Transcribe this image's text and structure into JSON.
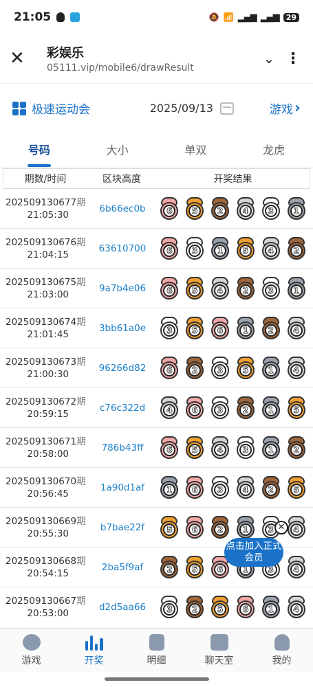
{
  "status": {
    "time": "21:05",
    "battery": "29"
  },
  "browser": {
    "title": "彩娱乐",
    "url": "05111.vip/mobile6/drawResult"
  },
  "game": {
    "name": "极速运动会",
    "date": "2025/09/13",
    "switch_label": "游戏"
  },
  "tabs": [
    "号码",
    "大小",
    "单双",
    "龙虎"
  ],
  "active_tab": 0,
  "table": {
    "headers": [
      "期数/时间",
      "区块高度",
      "开奖结果"
    ],
    "rows": [
      {
        "period": "202509130677",
        "qi": "期",
        "time": "21:05:30",
        "hash": "6b66ec0b",
        "balls": [
          6,
          5,
          2,
          4,
          3,
          1
        ]
      },
      {
        "period": "202509130676",
        "qi": "期",
        "time": "21:04:15",
        "hash": "63610700",
        "balls": [
          6,
          3,
          1,
          5,
          4,
          2
        ]
      },
      {
        "period": "202509130675",
        "qi": "期",
        "time": "21:03:00",
        "hash": "9a7b4e06",
        "balls": [
          6,
          5,
          4,
          2,
          3,
          1
        ]
      },
      {
        "period": "202509130674",
        "qi": "期",
        "time": "21:01:45",
        "hash": "3bb61a0e",
        "balls": [
          3,
          5,
          6,
          1,
          2,
          4
        ]
      },
      {
        "period": "202509130673",
        "qi": "期",
        "time": "21:00:30",
        "hash": "96266d82",
        "balls": [
          6,
          2,
          3,
          5,
          1,
          4
        ]
      },
      {
        "period": "202509130672",
        "qi": "期",
        "time": "20:59:15",
        "hash": "c76c322d",
        "balls": [
          4,
          6,
          3,
          2,
          1,
          5
        ]
      },
      {
        "period": "202509130671",
        "qi": "期",
        "time": "20:58:00",
        "hash": "786b43ff",
        "balls": [
          6,
          5,
          4,
          3,
          1,
          2
        ]
      },
      {
        "period": "202509130670",
        "qi": "期",
        "time": "20:56:45",
        "hash": "1a90d1af",
        "balls": [
          1,
          6,
          3,
          4,
          2,
          5
        ]
      },
      {
        "period": "202509130669",
        "qi": "期",
        "time": "20:55:30",
        "hash": "b7bae22f",
        "balls": [
          5,
          6,
          2,
          1,
          3,
          4
        ]
      },
      {
        "period": "202509130668",
        "qi": "期",
        "time": "20:54:15",
        "hash": "2ba5f9af",
        "balls": [
          2,
          5,
          6,
          1,
          3,
          4
        ]
      },
      {
        "period": "202509130667",
        "qi": "期",
        "time": "20:53:00",
        "hash": "d2d5aa66",
        "balls": [
          3,
          2,
          5,
          6,
          1,
          4
        ]
      }
    ]
  },
  "ball_colors": {
    "1": "#9aa3ad",
    "2": "#a0663a",
    "3": "#ffffff",
    "4": "#d5d5d5",
    "5": "#f0a030",
    "6": "#f2a8a8"
  },
  "float_badge": {
    "label": "点击加入正式会员"
  },
  "bottom_nav": [
    {
      "label": "游戏",
      "icon": "star-icon"
    },
    {
      "label": "开奖",
      "icon": "bar-chart-icon"
    },
    {
      "label": "明细",
      "icon": "list-icon"
    },
    {
      "label": "聊天室",
      "icon": "chat-icon"
    },
    {
      "label": "我的",
      "icon": "user-icon"
    }
  ],
  "active_nav": 1
}
